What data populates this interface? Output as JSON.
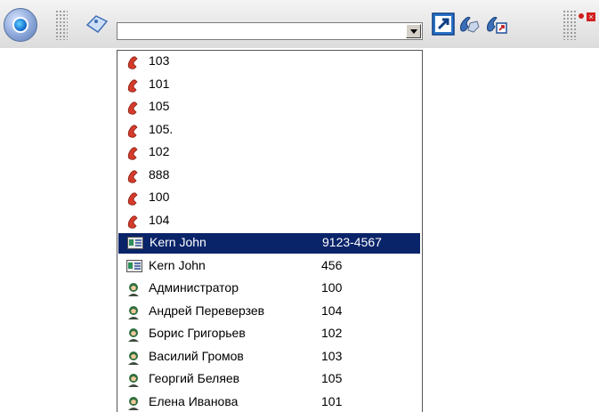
{
  "colors": {
    "selection": "#0a246a",
    "phone_red": "#d43c2c",
    "toolbar_bg": "#e4e4e4"
  },
  "toolbar": {
    "icons": [
      "app-menu-icon",
      "grip-icon",
      "tag-icon",
      "dropdown-arrow-icon",
      "open-window-icon",
      "hand-phone-icon",
      "phone-transfer-icon",
      "window-controls-icon"
    ]
  },
  "dropdown": {
    "recent_numbers": [
      {
        "label": "103"
      },
      {
        "label": "101"
      },
      {
        "label": "105"
      },
      {
        "label": "105."
      },
      {
        "label": "102"
      },
      {
        "label": "888"
      },
      {
        "label": "100"
      },
      {
        "label": "104"
      }
    ],
    "contacts": [
      {
        "name": "Kern John",
        "number": "9123-4567",
        "icon": "contact-card-icon",
        "selected": true
      },
      {
        "name": "Kern John",
        "number": "456",
        "icon": "contact-card-icon"
      },
      {
        "name": "Администратор",
        "number": "100",
        "icon": "user-icon"
      },
      {
        "name": "Андрей Переверзев",
        "number": "104",
        "icon": "user-icon"
      },
      {
        "name": "Борис Григорьев",
        "number": "102",
        "icon": "user-icon"
      },
      {
        "name": "Василий Громов",
        "number": "103",
        "icon": "user-icon"
      },
      {
        "name": "Георгий Беляев",
        "number": "105",
        "icon": "user-icon"
      },
      {
        "name": "Елена Иванова",
        "number": "101",
        "icon": "user-icon"
      }
    ]
  }
}
